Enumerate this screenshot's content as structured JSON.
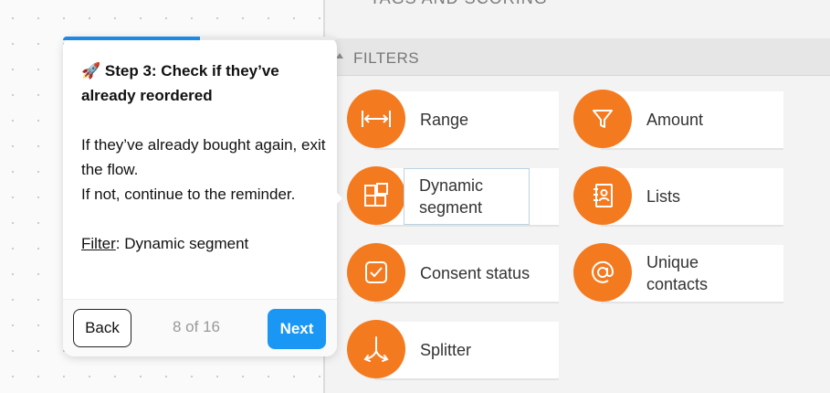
{
  "top_cut_text": "TAGS AND SCORING",
  "filters_label": "FILTERS",
  "items": [
    {
      "label": "Range",
      "icon": "range-arrows-icon"
    },
    {
      "label": "Amount",
      "icon": "funnel-icon"
    },
    {
      "label": "Dynamic segment",
      "icon": "segment-squares-icon"
    },
    {
      "label": "Lists",
      "icon": "contact-book-icon"
    },
    {
      "label": "Consent status",
      "icon": "checkbox-icon"
    },
    {
      "label": "Unique contacts",
      "icon": "at-sign-icon"
    },
    {
      "label": "Splitter",
      "icon": "splitter-arrows-icon"
    }
  ],
  "tooltip": {
    "title": "🚀 Step 3: Check if they’ve already reordered",
    "line1": "If they’ve already bought again, exit the flow.",
    "line2": "If not, continue to the reminder.",
    "filter_label": "Filter",
    "filter_value": ": Dynamic segment",
    "back_label": "Back",
    "counter": "8 of 16",
    "next_label": "Next",
    "progress": 0.5
  },
  "colors": {
    "accent": "#f47a1f",
    "primary": "#1a97f5"
  }
}
